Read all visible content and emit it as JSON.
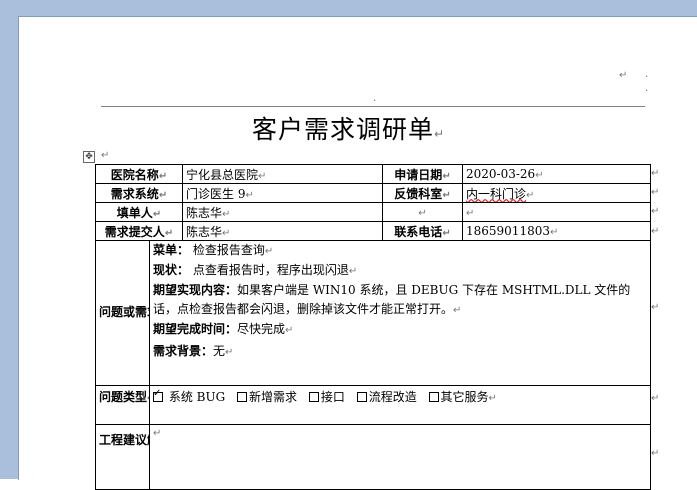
{
  "doc": {
    "title": "客户需求调研单",
    "para_mark": "↵"
  },
  "form": {
    "hospital_label": "医院名称",
    "hospital_value": "宁化县总医院",
    "apply_date_label": "申请日期",
    "apply_date_value": "2020-03-26",
    "system_label": "需求系统",
    "system_value": "门诊医生 9",
    "dept_label": "反馈科室",
    "dept_value": "内一科门诊",
    "filler_label": "填单人",
    "filler_value": "陈志华",
    "submitter_label": "需求提交人",
    "submitter_value": "陈志华",
    "phone_label": "联系电话",
    "phone_value": "18659011803",
    "problem_label": "问题或需求描述",
    "menu_key": "菜单：",
    "menu_value": "检查报告查询",
    "status_key": "现状：",
    "status_value": "点查看报告时，程序出现闪退",
    "expect_key": "期望实现内容：",
    "expect_value": "如果客户端是 WIN10 系统，且 DEBUG 下存在 MSHTML.DLL 文件的话，点检查报告都会闪退，删除掉该文件才能正常打开。",
    "deadline_key": "期望完成时间：",
    "deadline_value": "尽快完成",
    "background_key": "需求背景：",
    "background_value": "无",
    "type_label": "问题类型",
    "types": [
      {
        "label": "系统 BUG",
        "checked": true
      },
      {
        "label": "新增需求",
        "checked": false
      },
      {
        "label": "接口",
        "checked": false
      },
      {
        "label": "流程改造",
        "checked": false
      },
      {
        "label": "其它服务",
        "checked": false
      }
    ],
    "solution_label": "工程建议解决方案"
  }
}
